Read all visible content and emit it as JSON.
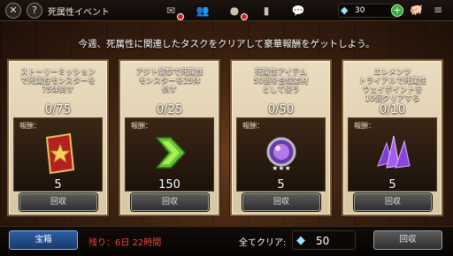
{
  "header": {
    "title": "死属性イベント",
    "back_icon": "back-icon",
    "help_label": "?",
    "gem_count": "30",
    "plus_label": "+",
    "icons": [
      "mail-icon",
      "friends-icon",
      "guild-icon",
      "bookmark-icon",
      "chat-icon"
    ]
  },
  "subtitle": "今週、死属性に関連したタスクをクリアして豪華報酬をゲットしよう。",
  "reward_label": "報酬：",
  "claim_label": "回収",
  "tasks": [
    {
      "desc": "ストーリーミッション\nで死属性モンスターを\n75体倒す",
      "progress": "0/75",
      "reward_count": "5",
      "item": "card"
    },
    {
      "desc": "アジト襲撃で死属性\nモンスターを25体\n倒す",
      "progress": "0/25",
      "reward_count": "150",
      "item": "arrow"
    },
    {
      "desc": "死属性アイテム\n50個を合成素材\nとして使う",
      "progress": "0/50",
      "reward_count": "5",
      "item": "orb"
    },
    {
      "desc": "エレメンツ\nトライアルで死属性\nウェイポイントを\n10個クリアする",
      "progress": "0/10",
      "reward_count": "5",
      "item": "crystal"
    }
  ],
  "footer": {
    "chest_label": "宝箱",
    "time_left": "残り：6日  22時間",
    "clear_all_label": "全てクリア:",
    "clear_all_gems": "50",
    "claim_all_label": "回収"
  }
}
